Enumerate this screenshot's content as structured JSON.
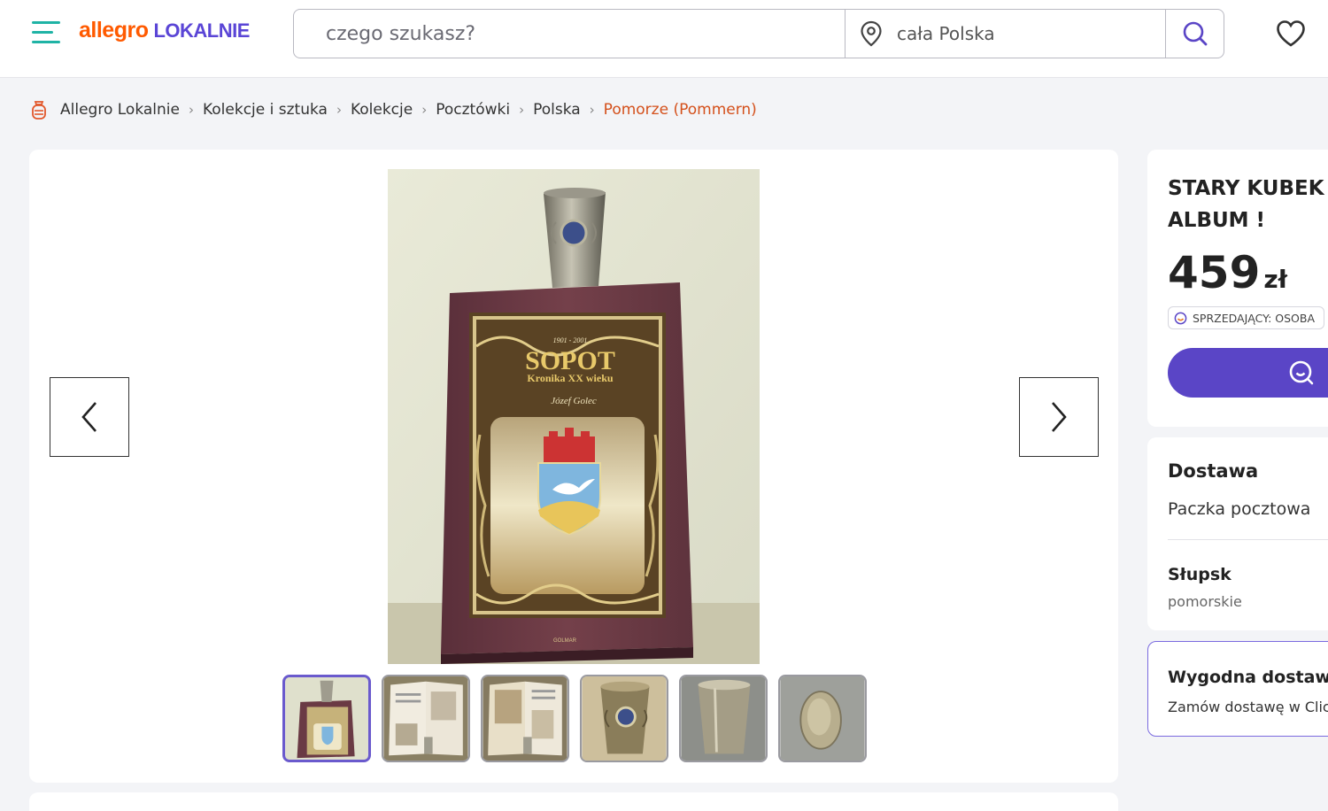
{
  "header": {
    "logo_main": "allegro",
    "logo_sub": "LOKALNIE",
    "search_placeholder": "czego szukasz?",
    "location": "cała Polska",
    "icons": [
      "menu-icon",
      "location-pin-icon",
      "search-icon",
      "heart-icon"
    ]
  },
  "breadcrumb": {
    "items": [
      "Allegro Lokalnie",
      "Kolekcje i sztuka",
      "Kolekcje",
      "Pocztówki",
      "Polska"
    ],
    "current": "Pomorze (Pommern)"
  },
  "gallery": {
    "book": {
      "years": "1901 - 2001",
      "title": "SOPOT",
      "subtitle": "Kronika XX wieku",
      "author": "Józef Golec",
      "publisher": "GOLMAR"
    },
    "thumbnails": [
      {
        "desc": "book-with-cup",
        "active": true
      },
      {
        "desc": "open-book-spread-1",
        "active": false
      },
      {
        "desc": "open-book-spread-2",
        "active": false
      },
      {
        "desc": "cup-with-emblem",
        "active": false
      },
      {
        "desc": "cup-side",
        "active": false
      },
      {
        "desc": "cup-bottom",
        "active": false
      }
    ]
  },
  "offer": {
    "title": "STARY KUBEK Z ALBUM !",
    "price": "459",
    "currency": "zł",
    "seller_badge": "SPRZEDAJĄCY: OSOBA"
  },
  "delivery": {
    "heading": "Dostawa",
    "method": "Paczka pocztowa",
    "city": "Słupsk",
    "region": "pomorskie"
  },
  "promo": {
    "heading": "Wygodna dostawa",
    "text": "Zamów dostawę w Click"
  },
  "colors": {
    "accent": "#5a45c6",
    "brand_orange": "#ff5a00",
    "breadcrumb_current": "#d4501b",
    "menu_teal": "#1fb3a5"
  }
}
